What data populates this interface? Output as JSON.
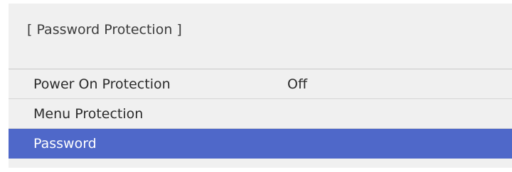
{
  "panel": {
    "title": "[ Password Protection ]"
  },
  "menu": {
    "items": [
      {
        "label": "Power On Protection",
        "value": "Off",
        "selected": false
      },
      {
        "label": "Menu Protection",
        "value": "",
        "selected": false
      },
      {
        "label": "Password",
        "value": "",
        "selected": true
      }
    ]
  },
  "colors": {
    "panel_background": "#f0f0f0",
    "selection_highlight": "#4f68c9",
    "text": "#2b2b2b",
    "selected_text": "#ffffff"
  }
}
